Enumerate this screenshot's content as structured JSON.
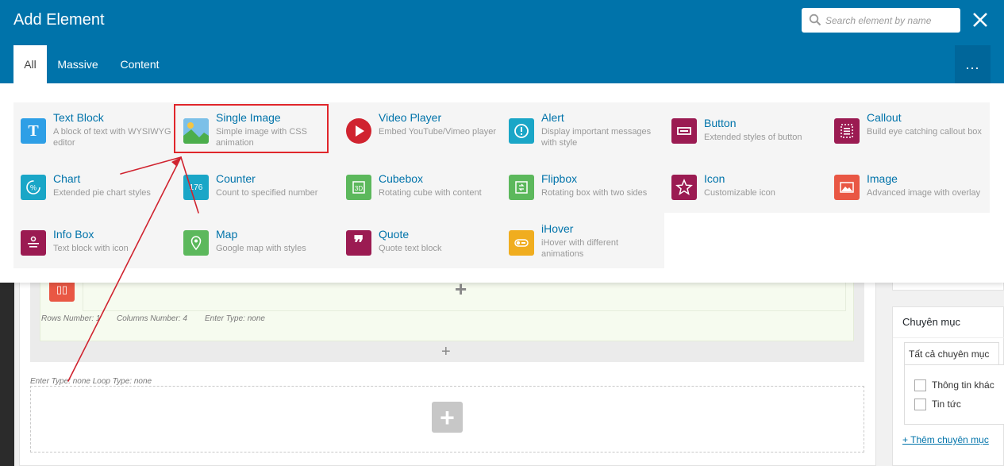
{
  "modal": {
    "title": "Add Element",
    "search_placeholder": "Search element by name",
    "close_label": "✕",
    "tabs": [
      {
        "label": "All",
        "active": true
      },
      {
        "label": "Massive",
        "active": false
      },
      {
        "label": "Content",
        "active": false
      }
    ],
    "more_label": "..."
  },
  "elements": [
    {
      "title": "Text Block",
      "desc": "A block of text with WYSIWYG editor",
      "icon": "text-block-icon",
      "color": "#2e9fe6"
    },
    {
      "title": "Single Image",
      "desc": "Simple image with CSS animation",
      "icon": "single-image-icon",
      "color": "#7cc0e8"
    },
    {
      "title": "Video Player",
      "desc": "Embed YouTube/Vimeo player",
      "icon": "video-player-icon",
      "color": "#d0232f"
    },
    {
      "title": "Alert",
      "desc": "Display important messages with style",
      "icon": "alert-icon",
      "color": "#1aa6c7"
    },
    {
      "title": "Button",
      "desc": "Extended styles of button",
      "icon": "button-icon",
      "color": "#9b1b52"
    },
    {
      "title": "Callout",
      "desc": "Build eye catching callout box",
      "icon": "callout-icon",
      "color": "#9b1b52"
    },
    {
      "title": "Chart",
      "desc": "Extended pie chart styles",
      "icon": "chart-icon",
      "color": "#1aa6c7"
    },
    {
      "title": "Counter",
      "desc": "Count to specified number",
      "icon": "counter-icon",
      "color": "#1aa6c7"
    },
    {
      "title": "Cubebox",
      "desc": "Rotating cube with content",
      "icon": "cubebox-icon",
      "color": "#5cb85c"
    },
    {
      "title": "Flipbox",
      "desc": "Rotating box with two sides",
      "icon": "flipbox-icon",
      "color": "#5cb85c"
    },
    {
      "title": "Icon",
      "desc": "Customizable icon",
      "icon": "star-icon",
      "color": "#9b1b52"
    },
    {
      "title": "Image",
      "desc": "Advanced image with overlay",
      "icon": "image-icon",
      "color": "#e95744"
    },
    {
      "title": "Info Box",
      "desc": "Text block with icon",
      "icon": "info-box-icon",
      "color": "#9b1b52"
    },
    {
      "title": "Map",
      "desc": "Google map with styles",
      "icon": "map-icon",
      "color": "#5cb85c"
    },
    {
      "title": "Quote",
      "desc": "Quote text block",
      "icon": "quote-icon",
      "color": "#9b1b52"
    },
    {
      "title": "iHover",
      "desc": "iHover with different animations",
      "icon": "ihover-icon",
      "color": "#f0ad1f"
    }
  ],
  "background": {
    "rows_meta": {
      "rows": "Rows Number: 1",
      "cols": "Columns Number: 4",
      "enter": "Enter Type: none"
    },
    "loop_meta": "Enter Type: none  Loop Type: none",
    "plus_label": "+",
    "sidebar": {
      "title": "Chuyên mục",
      "tab": "Tất cả chuyên mục",
      "categories": [
        "Thông tin khác",
        "Tin tức"
      ],
      "add_link": "+ Thêm chuyên mục"
    }
  },
  "annotation_color": "#d0232f"
}
